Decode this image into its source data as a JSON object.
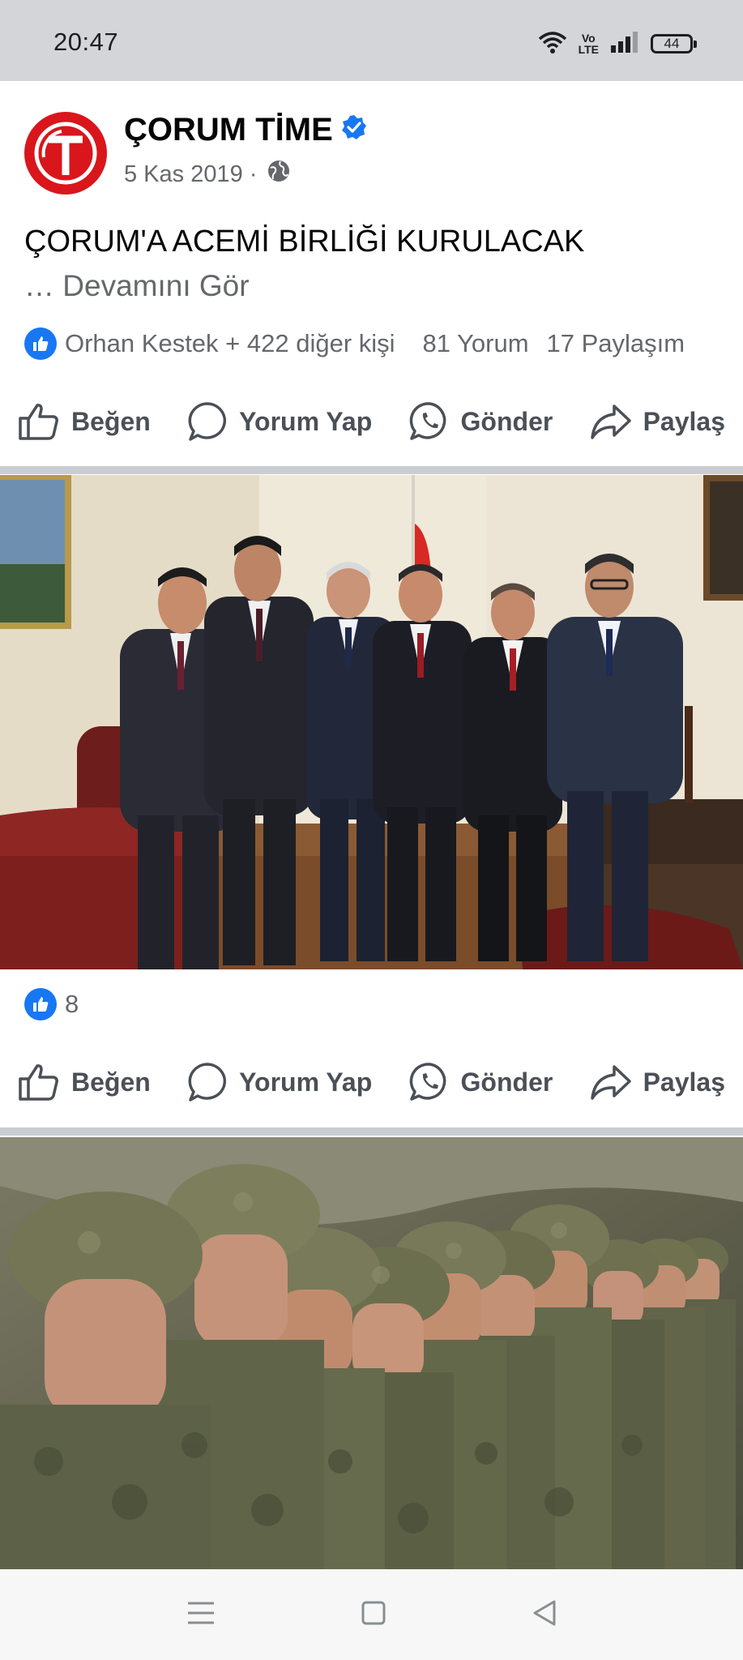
{
  "status_bar": {
    "time": "20:47",
    "volte_top": "Vo",
    "volte_bottom": "LTE",
    "battery": "44"
  },
  "post": {
    "page_name": "ÇORUM TİME",
    "date": "5 Kas 2019 ·",
    "text": "ÇORUM'A ACEMİ BİRLİĞİ KURULACAK",
    "see_more": "… Devamını Gör",
    "reactions_text": "Orhan Kestek + 422 diğer kişi",
    "comments": "81 Yorum",
    "shares": "17 Paylaşım",
    "actions": {
      "like": "Beğen",
      "comment": "Yorum Yap",
      "send": "Gönder",
      "share": "Paylaş"
    }
  },
  "photo_1": {
    "reaction_count": "8",
    "actions": {
      "like": "Beğen",
      "comment": "Yorum Yap",
      "send": "Gönder",
      "share": "Paylaş"
    }
  },
  "colors": {
    "facebook_blue": "#1877f2",
    "logo_red": "#d9161c",
    "status_bar": "#d3d5d8",
    "divider": "#c9ccd1"
  },
  "icons": [
    "wifi-icon",
    "signal-icon",
    "battery-icon",
    "verified-badge-icon",
    "globe-icon",
    "like-badge-icon",
    "thumbs-up-icon",
    "comment-icon",
    "whatsapp-icon",
    "share-icon",
    "menu-icon",
    "home-icon",
    "back-icon"
  ]
}
